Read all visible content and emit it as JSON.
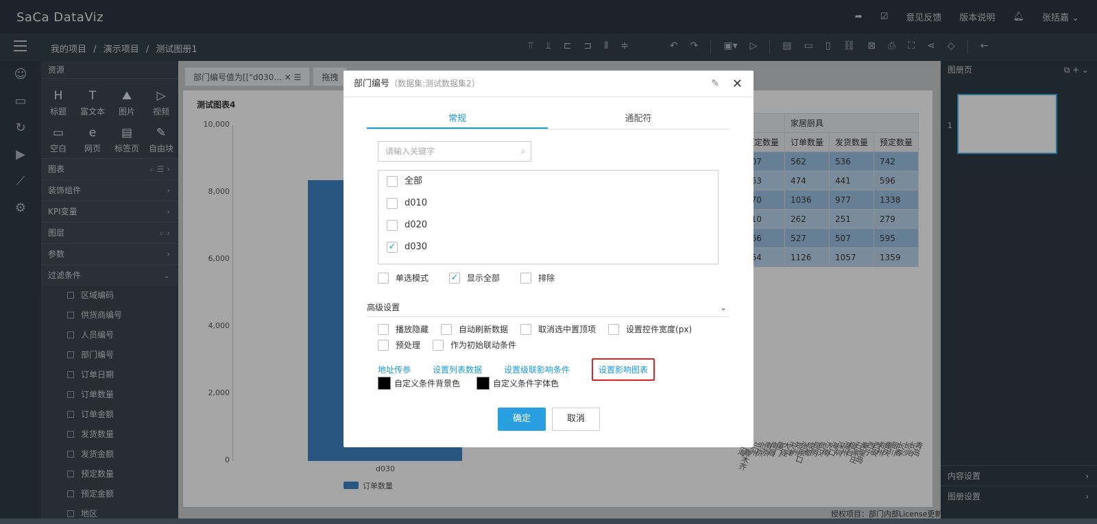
{
  "app": {
    "logo": "Sa&#7443;a DataViz",
    "logo_text": "SaCa DataViz"
  },
  "topbar": {
    "feedback": "意见反馈",
    "version": "版本说明",
    "user": "张括嘉"
  },
  "breadcrumb": [
    "我的项目",
    "/",
    "演示项目",
    "/",
    "测试图册1"
  ],
  "left_panel": {
    "title": "资源",
    "components": [
      {
        "icon": "H",
        "label": "标题"
      },
      {
        "icon": "T",
        "label": "富文本"
      },
      {
        "icon": "⛰",
        "label": "图片"
      },
      {
        "icon": "▷",
        "label": "视频"
      },
      {
        "icon": "▭",
        "label": "空白"
      },
      {
        "icon": "e",
        "label": "网页"
      },
      {
        "icon": "▤",
        "label": "标签页"
      },
      {
        "icon": "✎",
        "label": "自由块"
      }
    ],
    "sections": [
      "图表",
      "装饰组件",
      "KPI变量",
      "图层",
      "参数",
      "过滤条件"
    ],
    "fields": [
      "区域编码",
      "供货商编号",
      "人员编号",
      "部门编号",
      "订单日期",
      "订单数量",
      "订单金额",
      "发货数量",
      "发货金额",
      "预定数量",
      "预定金额",
      "地区"
    ]
  },
  "canvas": {
    "tabs": [
      "部门编号值为[[\"d030...",
      "拖拽"
    ],
    "chart_title": "测试图表4",
    "legend": "订单数量",
    "license": "授权项目：部门内部License更新"
  },
  "chart_data": {
    "type": "bar",
    "title": "测试图表4",
    "categories": [
      "d030"
    ],
    "series": [
      {
        "name": "订单数量",
        "values": [
          8350
        ]
      }
    ],
    "ylim": [
      0,
      10000
    ],
    "yticks": [
      "10,000",
      "8,000",
      "6,000",
      "4,000",
      "2,000",
      "0"
    ]
  },
  "table": {
    "group_header": "家居厨具",
    "headers": [
      "预定数量",
      "订单数量",
      "发货数量",
      "预定数量"
    ],
    "rows": [
      [
        "307",
        "562",
        "536",
        "742"
      ],
      [
        "363",
        "474",
        "441",
        "596"
      ],
      [
        "670",
        "1036",
        "977",
        "1338"
      ],
      [
        "110",
        "262",
        "251",
        "279"
      ],
      [
        "466",
        "527",
        "507",
        "595"
      ],
      [
        "764",
        "1126",
        "1057",
        "1359"
      ]
    ]
  },
  "city_labels": [
    "上海",
    "乌鲁木齐",
    "兰州",
    "北京",
    "南京",
    "南昌",
    "厦门",
    "大连",
    "天津",
    "郑州",
    "张家口",
    "成都",
    "昆明",
    "武汉",
    "济南",
    "海口",
    "深圳",
    "温州",
    "烟台",
    "石家庄",
    "秦皇岛",
    "西宁",
    "西安",
    "郑州",
    "重庆",
    "银川",
    "长春",
    "长沙",
    "长治",
    "青岛"
  ],
  "right_panel": {
    "title": "图册页",
    "page_num": "1",
    "content_settings": "内容设置",
    "page_settings": "图册设置"
  },
  "dialog": {
    "title": "部门编号",
    "subtitle": "（数据集:测试数据集2）",
    "tabs": [
      "常规",
      "通配符"
    ],
    "search_placeholder": "请输入关键字",
    "items": [
      {
        "label": "全部",
        "checked": false
      },
      {
        "label": "d010",
        "checked": false
      },
      {
        "label": "d020",
        "checked": false
      },
      {
        "label": "d030",
        "checked": true
      }
    ],
    "options": [
      {
        "label": "单选模式",
        "checked": false
      },
      {
        "label": "显示全部",
        "checked": true
      },
      {
        "label": "排除",
        "checked": false
      }
    ],
    "advanced_label": "高级设置",
    "advanced_row1": [
      "播放隐藏",
      "自动刷新数据",
      "取消选中置顶项",
      "设置控件宽度(px)"
    ],
    "advanced_row2": [
      "预处理",
      "作为初始联动条件"
    ],
    "links": [
      "地址传参",
      "设置列表数据",
      "设置级联影响条件",
      "设置影响图表"
    ],
    "bg_color_label": "自定义条件背景色",
    "font_color_label": "自定义条件字体色",
    "ok": "确定",
    "cancel": "取消",
    "accent_color": "#1b9ad6",
    "highlight_color": "#e02020"
  }
}
